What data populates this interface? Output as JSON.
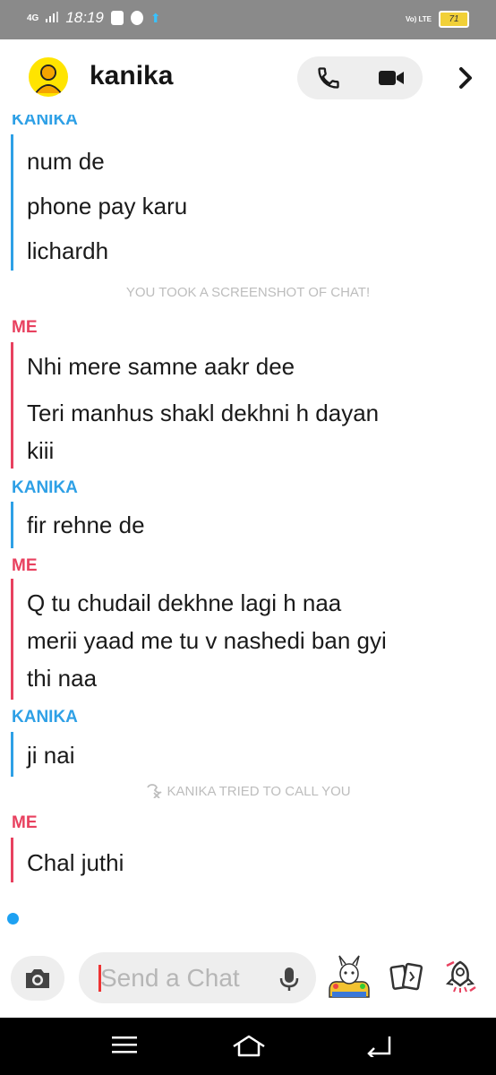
{
  "status_bar": {
    "time": "18:19",
    "network": "4G",
    "volte": "Vo) LTE",
    "battery": "71"
  },
  "header": {
    "contact_name": "kanika",
    "icons": [
      "avatar-icon",
      "phone-icon",
      "video-camera-icon",
      "chevron-right-icon"
    ]
  },
  "messages": [
    {
      "sender_label": "KANIKA",
      "texts": [
        "num de",
        "phone pay karu",
        "lichardh"
      ]
    },
    {
      "system": "YOU TOOK A SCREENSHOT OF CHAT!"
    },
    {
      "sender_label": "ME",
      "texts": [
        "Nhi mere samne aakr dee",
        "Teri manhus shakl dekhni h dayan",
        "kiii"
      ]
    },
    {
      "sender_label": "KANIKA",
      "texts": [
        "fir rehne de"
      ]
    },
    {
      "sender_label": "ME",
      "texts": [
        "Q tu chudail dekhne lagi  h naa",
        "merii yaad me tu v nashedi ban gyi",
        "thi naa"
      ]
    },
    {
      "sender_label": "KANIKA",
      "texts": [
        "ji nai"
      ]
    },
    {
      "system": "KANIKA TRIED TO CALL YOU"
    },
    {
      "sender_label": "ME",
      "texts": [
        "Chal juthi"
      ]
    }
  ],
  "compose": {
    "placeholder": "Send a Chat",
    "icons": [
      "camera-icon",
      "microphone-icon",
      "bitmoji-icon",
      "cards-icon",
      "rocket-icon"
    ]
  },
  "colors": {
    "them": "#2ea0e6",
    "me": "#e8415f",
    "status_bar": "#8a8a8a",
    "avatar": "#ffe400",
    "nav_bar": "#000000"
  }
}
